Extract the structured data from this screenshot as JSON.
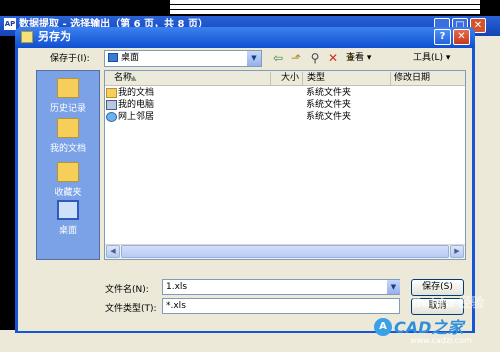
{
  "background_window": {
    "title": "数据提取 - 选择输出（第 6 页，共 8 页）",
    "app_icon": "AP"
  },
  "dialog": {
    "title": "另存为",
    "help_glyph": "?",
    "close_glyph": "✕",
    "save_in_label": "保存于(I):",
    "save_in_value": "桌面",
    "views_label": "查看",
    "tools_label": "工具(L)"
  },
  "places": [
    {
      "label": "历史记录",
      "icon": "history-folder-icon"
    },
    {
      "label": "我的文档",
      "icon": "my-documents-icon"
    },
    {
      "label": "收藏夹",
      "icon": "favorites-folder-icon"
    },
    {
      "label": "桌面",
      "icon": "desktop-icon"
    }
  ],
  "columns": {
    "name": "名称",
    "size": "大小",
    "type": "类型",
    "date": "修改日期"
  },
  "files": [
    {
      "name": "我的文档",
      "type": "系统文件夹",
      "icon": "folder-icon"
    },
    {
      "name": "我的电脑",
      "type": "系统文件夹",
      "icon": "computer-icon"
    },
    {
      "name": "网上邻居",
      "type": "系统文件夹",
      "icon": "network-icon"
    }
  ],
  "footer": {
    "file_name_label": "文件名(N):",
    "file_name_value": "1.xls",
    "file_type_label": "文件类型(T):",
    "file_type_value": "*.xls",
    "save_label": "保存(S)",
    "cancel_label": "取消"
  },
  "watermarks": {
    "baidu": "Baidu 经验",
    "logo": "A",
    "cad": "CAD之家",
    "url": "www.cadzj.com"
  }
}
